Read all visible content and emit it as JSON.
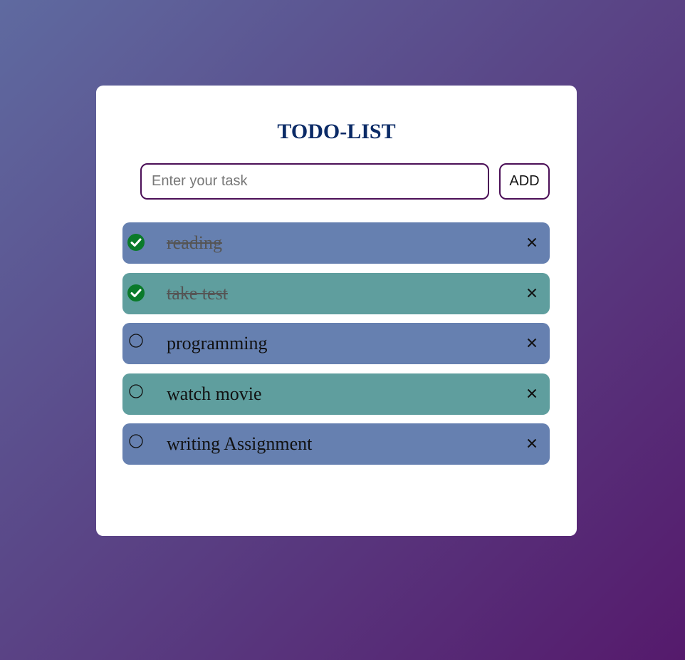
{
  "app": {
    "title": "TODO-LIST"
  },
  "input": {
    "placeholder": "Enter your task",
    "value": ""
  },
  "add_button": {
    "label": "ADD"
  },
  "tasks": [
    {
      "text": "reading",
      "done": true
    },
    {
      "text": "take test",
      "done": true
    },
    {
      "text": "programming",
      "done": false
    },
    {
      "text": "watch movie",
      "done": false
    },
    {
      "text": "writing Assignment",
      "done": false
    }
  ],
  "icons": {
    "checked": "check-circle-icon",
    "unchecked": "empty-circle-icon",
    "delete": "close-icon"
  },
  "colors": {
    "accent_title": "#0a2a66",
    "row_blue": "#6680b0",
    "row_teal": "#5f9e9e",
    "check_green": "#0a7a2a",
    "input_border": "#4b0f57"
  }
}
